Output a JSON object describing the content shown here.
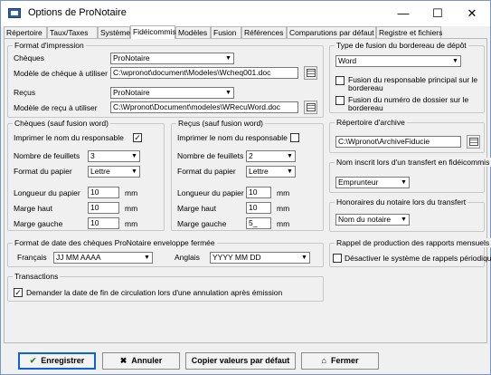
{
  "window": {
    "title": "Options de ProNotaire",
    "minimize": "—",
    "maximize": "☐",
    "close": "✕"
  },
  "tabs": [
    "Répertoire",
    "Taux/Taxes",
    "Système",
    "Fidéicommis",
    "Modèles",
    "Fusion",
    "Références",
    "Comparutions par défaut",
    "Registre et fichiers"
  ],
  "active_tab": "Fidéicommis",
  "print_format": {
    "title": "Format d'impression",
    "cheques_label": "Chèques",
    "cheques_value": "ProNotaire",
    "cheque_model_label": "Modèle de chèque à utiliser",
    "cheque_model_value": "C:\\wpronot\\document\\Modeles\\Wcheq001.doc",
    "recus_label": "Reçus",
    "recus_value": "ProNotaire",
    "recu_model_label": "Modèle de reçu à utiliser",
    "recu_model_value": "C:\\Wpronot\\Document\\modeles\\WRecuWord.doc"
  },
  "cheques": {
    "title": "Chèques (sauf fusion word)",
    "print_name_label": "Imprimer le nom du responsable",
    "print_name_checked": "✓",
    "sheets_label": "Nombre de feuillets",
    "sheets_value": "3",
    "paper_label": "Format du papier",
    "paper_value": "Lettre",
    "length_label": "Longueur du papier",
    "length_value": "10",
    "length_unit": "mm",
    "top_label": "Marge haut",
    "top_value": "10",
    "top_unit": "mm",
    "left_label": "Marge gauche",
    "left_value": "10",
    "left_unit": "mm"
  },
  "recus": {
    "title": "Reçus (sauf fusion word)",
    "print_name_label": "Imprimer le nom du responsable",
    "print_name_checked": "",
    "sheets_label": "Nombre de feuillets",
    "sheets_value": "2",
    "paper_label": "Format du papier",
    "paper_value": "Lettre",
    "length_label": "Longueur du papier",
    "length_value": "10",
    "length_unit": "mm",
    "top_label": "Marge haut",
    "top_value": "10",
    "top_unit": "mm",
    "left_label": "Marge gauche",
    "left_value": "5_",
    "left_unit": "mm"
  },
  "date_format": {
    "title": "Format de date des chèques ProNotaire enveloppe fermée",
    "fr_label": "Français",
    "fr_value": "JJ MM AAAA",
    "en_label": "Anglais",
    "en_value": "YYYY MM DD"
  },
  "transactions": {
    "title": "Transactions",
    "ask_date_label": "Demander la date de fin de circulation lors d'une annulation après émission",
    "ask_date_checked": "✓"
  },
  "merge_type": {
    "title": "Type de fusion du bordereau de dépôt",
    "value": "Word",
    "opt1_line1": "Fusion du responsable principal sur le",
    "opt1_line2": "bordereau",
    "opt1_checked": "",
    "opt2_line1": "Fusion du numéro de dossier sur le",
    "opt2_line2": "bordereau",
    "opt2_checked": ""
  },
  "archive": {
    "title": "Répertoire d'archive",
    "value": "C:\\Wpronot\\ArchiveFiducie"
  },
  "transfer_name": {
    "title": "Nom inscrit lors d'un transfert en fidéicommis",
    "value": "Emprunteur"
  },
  "fees": {
    "title": "Honoraires du notaire lors du transfert",
    "value": "Nom du notaire"
  },
  "reminders": {
    "title": "Rappel de production des rapports mensuels",
    "disable_label": "Désactiver le système de rappels périodiques",
    "disable_checked": ""
  },
  "buttons": {
    "save": "Enregistrer",
    "save_icon": "✔",
    "cancel": "Annuler",
    "cancel_icon": "✖",
    "copy_defaults": "Copier valeurs par défaut",
    "close": "Fermer",
    "close_icon": "⌂"
  },
  "combo_arrow": "▼"
}
